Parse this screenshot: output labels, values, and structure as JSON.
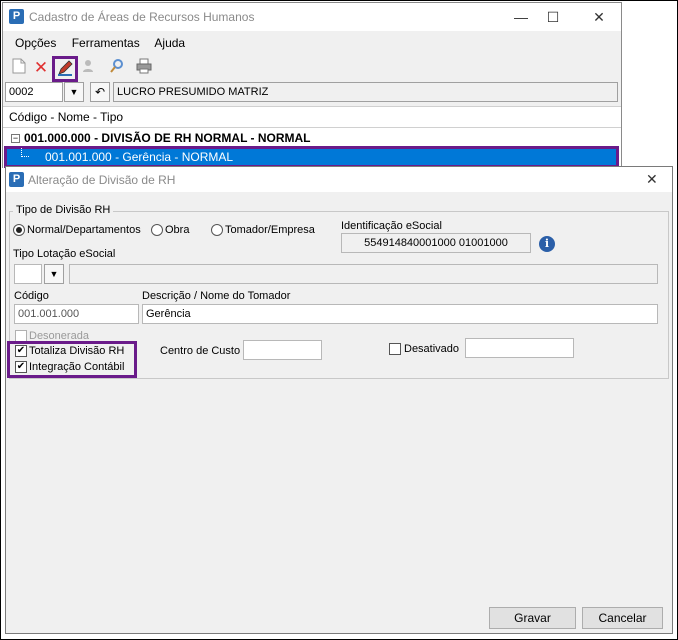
{
  "main_window": {
    "title": "Cadastro de Áreas de Recursos Humanos",
    "app_icon_letter": "P",
    "minimize_glyph": "—",
    "maximize_glyph": "☐",
    "close_glyph": "✕",
    "menu": [
      "Opções",
      "Ferramentas",
      "Ajuda"
    ],
    "toolbar_icons": [
      "new-document-icon",
      "delete-icon",
      "edit-pencil-icon",
      "user-search-icon",
      "search-icon",
      "print-icon"
    ],
    "company_code": "0002",
    "company_name": "LUCRO PRESUMIDO MATRIZ",
    "tree_header": "Código - Nome - Tipo",
    "tree_collapse_glyph": "−",
    "tree_root": "001.000.000 - DIVISÃO DE RH NORMAL - NORMAL",
    "tree_child": "001.001.000 - Gerência - NORMAL"
  },
  "dialog": {
    "title": "Alteração de Divisão de RH",
    "close_glyph": "✕",
    "tipo_divisao": {
      "legend": "Tipo de Divisão RH",
      "options": [
        "Normal/Departamentos",
        "Obra",
        "Tomador/Empresa"
      ],
      "selected": "Normal/Departamentos"
    },
    "identificacao_esocial": {
      "label": "Identificação eSocial",
      "value": "554914840001000 01001000",
      "info_glyph": "i"
    },
    "tipo_lotacao": {
      "label": "Tipo Lotação eSocial",
      "value": ""
    },
    "codigo": {
      "label": "Código",
      "value": "001.001.000"
    },
    "descricao": {
      "label": "Descrição / Nome do Tomador",
      "value": "Gerência"
    },
    "desonerada": {
      "label": "Desonerada",
      "checked": false,
      "enabled": false
    },
    "totaliza": {
      "label": "Totaliza Divisão RH",
      "checked": true
    },
    "integracao": {
      "label": "Integração Contábil",
      "checked": true
    },
    "centro_custo": {
      "label": "Centro de Custo",
      "value": ""
    },
    "desativado": {
      "label": "Desativado",
      "checked": false,
      "value": ""
    },
    "check_glyph": "✔",
    "buttons": {
      "gravar": "Gravar",
      "cancelar": "Cancelar"
    }
  },
  "colors": {
    "highlight": "#6a1b8a",
    "selection": "#0078d7",
    "window_bg": "#f0f0f0"
  }
}
